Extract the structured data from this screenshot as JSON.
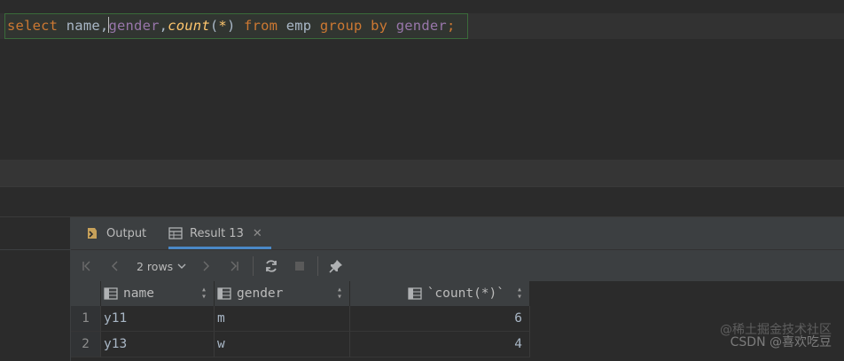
{
  "editor": {
    "tokens": {
      "select": "select",
      "name": "name",
      "comma1": ",",
      "gender1": "gender",
      "comma2": ",",
      "count": "count",
      "paren_open": "(",
      "star": "*",
      "paren_close": ")",
      "from": "from",
      "table": "emp",
      "group": "group",
      "by": "by",
      "gender2": "gender",
      "semicolon": ";"
    }
  },
  "tabs": {
    "output_label": "Output",
    "result_label": "Result 13",
    "close_glyph": "✕"
  },
  "toolbar": {
    "rows_label": "2 rows"
  },
  "grid": {
    "columns": [
      "name",
      "gender",
      "`count(*)`"
    ],
    "rows": [
      {
        "num": "1",
        "name": "y11",
        "gender": "m",
        "count": "6"
      },
      {
        "num": "2",
        "name": "y13",
        "gender": "w",
        "count": "4"
      }
    ]
  },
  "watermark": {
    "line1": "@稀土掘金技术社区",
    "line2": "CSDN @喜欢吃豆"
  },
  "colors": {
    "keyword": "#cc7832",
    "column": "#9876aa",
    "function": "#ffc66d",
    "tab_underline": "#4a88c7"
  }
}
